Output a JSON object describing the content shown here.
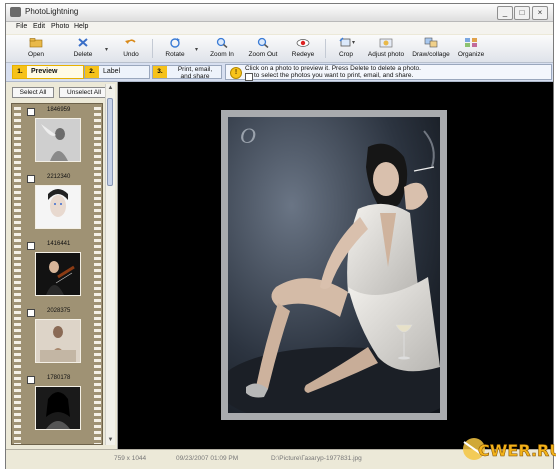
{
  "window": {
    "title": "PhotoLightning"
  },
  "menu": [
    "File",
    "Edit",
    "Photo",
    "Help"
  ],
  "toolbar": [
    {
      "label": "Open",
      "icon": "open-icon"
    },
    {
      "label": "Delete",
      "icon": "delete-icon"
    },
    {
      "label": "Undo",
      "icon": "undo-icon"
    },
    {
      "label": "Rotate",
      "icon": "rotate-icon"
    },
    {
      "label": "Zoom In",
      "icon": "zoom-in-icon"
    },
    {
      "label": "Zoom Out",
      "icon": "zoom-out-icon"
    },
    {
      "label": "Redeye",
      "icon": "redeye-icon"
    },
    {
      "label": "Crop",
      "icon": "crop-icon"
    },
    {
      "label": "Adjust photo",
      "icon": "adjust-photo-icon"
    },
    {
      "label": "Draw/collage",
      "icon": "draw-collage-icon"
    },
    {
      "label": "Organize",
      "icon": "organize-icon"
    }
  ],
  "steps": [
    {
      "num": "1.",
      "label": "Preview",
      "active": true
    },
    {
      "num": "2.",
      "label": "Label",
      "active": false
    },
    {
      "num": "3.",
      "label": "Print, email,\nand share",
      "active": false
    }
  ],
  "hint": {
    "line1": "Click on a photo to preview it.  Press Delete to delete a photo.",
    "line2": "to select the photos you want to print, email, and share."
  },
  "sidebar": {
    "select_all": "Select All",
    "unselect_all": "Unselect All",
    "thumbnails": [
      {
        "number": "1846959"
      },
      {
        "number": "2212340"
      },
      {
        "number": "1416441"
      },
      {
        "number": "2028375"
      },
      {
        "number": "1780178"
      }
    ]
  },
  "preview": {
    "logo_letter": "O"
  },
  "status": {
    "dimensions": "759 x 1044",
    "date": "09/23/2007  01:09 PM",
    "path": "D:\\Picture\\Газагур-1977831.jpg"
  },
  "watermark": {
    "text": "CWER.RU"
  },
  "colors": {
    "step_accent": "#f6c21a",
    "preview_bg": "#000000",
    "filmstrip": "#9f9274"
  }
}
